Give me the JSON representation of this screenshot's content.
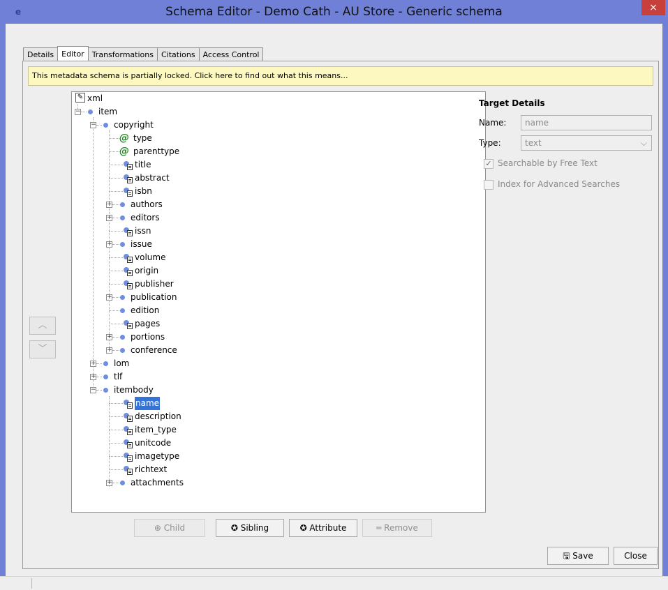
{
  "window": {
    "title": "Schema Editor - Demo Cath - AU Store - Generic schema",
    "close": "×"
  },
  "tabs": [
    {
      "label": "Details"
    },
    {
      "label": "Editor"
    },
    {
      "label": "Transformations"
    },
    {
      "label": "Citations"
    },
    {
      "label": "Access Control"
    }
  ],
  "active_tab": "Editor",
  "banner": "This metadata schema is partially locked.  Click here to find out what this means...",
  "tree": {
    "root": "xml",
    "item": "item",
    "copyright": "copyright",
    "type": "type",
    "parenttype": "parenttype",
    "title": "title",
    "abstract": "abstract",
    "isbn": "isbn",
    "authors": "authors",
    "editors": "editors",
    "issn": "issn",
    "issue": "issue",
    "volume": "volume",
    "origin": "origin",
    "publisher": "publisher",
    "publication": "publication",
    "edition": "edition",
    "pages": "pages",
    "portions": "portions",
    "conference": "conference",
    "lom": "lom",
    "tlf": "tlf",
    "itembody": "itembody",
    "name": "name",
    "description": "description",
    "item_type": "item_type",
    "unitcode": "unitcode",
    "imagetype": "imagetype",
    "richtext": "richtext",
    "attachments": "attachments",
    "selected": "name"
  },
  "move": {
    "up": "︿",
    "down": "﹀"
  },
  "buttons": {
    "child": "⊕ Child",
    "sibling": "✪ Sibling",
    "attribute": "✪ Attribute",
    "remove": "═ Remove"
  },
  "target": {
    "title": "Target Details",
    "name_label": "Name:",
    "name_value": "name",
    "type_label": "Type:",
    "type_value": "text",
    "searchable_label": "Searchable by Free Text",
    "searchable_checked": true,
    "index_label": "Index for Advanced Searches",
    "index_checked": false
  },
  "footer": {
    "save": "🖫 Save",
    "close": "Close"
  }
}
